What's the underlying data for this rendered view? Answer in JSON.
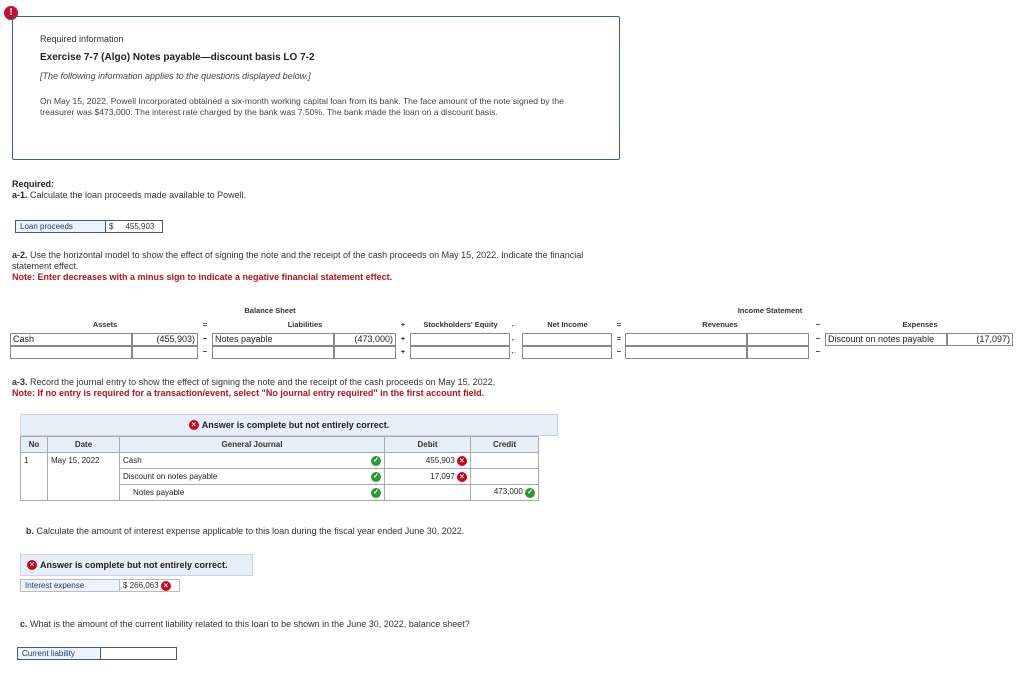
{
  "alert": {
    "icon": "!"
  },
  "info": {
    "required_label": "Required information",
    "title": "Exercise 7-7 (Algo) Notes payable—discount basis LO 7-2",
    "italic": "[The following information applies to the questions displayed below.]",
    "paragraph": "On May 15, 2022, Powell Incorporated obtained a six-month working capital loan from its bank. The face amount of the note signed by the treasurer was $473,000. The interest rate charged by the bank was 7.50%. The bank made the loan on a discount basis."
  },
  "required": {
    "label": "Required:",
    "a1_num": "a-1.",
    "a1_text": " Calculate the loan proceeds made available to Powell."
  },
  "loan_proceeds": {
    "label": "Loan proceeds",
    "dollar": "$",
    "value": "455,903"
  },
  "a2": {
    "num": "a-2.",
    "text": " Use the horizontal model to show the effect of signing the note and the receipt of the cash proceeds on May 15, 2022. Indicate the financial statement effect.",
    "note": "Note: Enter decreases with a minus sign to indicate a negative financial statement effect."
  },
  "horizontal_model": {
    "balance_sheet": "Balance Sheet",
    "income_statement": "Income Statement",
    "assets": "Assets",
    "liabilities": "Liabilities",
    "equity": "Stockholders' Equity",
    "net_income": "Net Income",
    "revenues": "Revenues",
    "expenses": "Expenses",
    "eq": "=",
    "plus": "+",
    "minus": "−",
    "arrow": "←",
    "row1": {
      "asset_label": "Cash",
      "asset_value": "(455,903)",
      "liab_label": "Notes payable",
      "liab_value": "(473,000)",
      "exp_label": "Discount on notes payable",
      "exp_value": "(17,097)"
    }
  },
  "a3": {
    "num": "a-3.",
    "text": " Record the journal entry to show the effect of signing the note and the receipt of the cash proceeds on May 15, 2022.",
    "note": "Note: If no entry is required for a transaction/event, select \"No journal entry required\" in the first account field."
  },
  "banner_text": "Answer is complete but not entirely correct.",
  "journal": {
    "headers": {
      "no": "No",
      "date": "Date",
      "gj": "General Journal",
      "debit": "Debit",
      "credit": "Credit"
    },
    "no": "1",
    "date": "May 15, 2022",
    "rows": [
      {
        "account": "Cash",
        "debit": "455,903",
        "credit": ""
      },
      {
        "account": "Discount on notes payable",
        "debit": "17,097",
        "credit": ""
      },
      {
        "account": "Notes payable",
        "debit": "",
        "credit": "473,000"
      }
    ]
  },
  "b": {
    "num": "b.",
    "text": " Calculate the amount of interest expense applicable to this loan during the fiscal year ended June 30, 2022."
  },
  "interest": {
    "label": "Interest expense",
    "value": "$ 266,063"
  },
  "c": {
    "num": "c.",
    "text": " What is the amount of the current liability related to this loan to be shown in the June 30, 2022, balance sheet?"
  },
  "current_liability": {
    "label": "Current liability",
    "value": ""
  },
  "colors": {
    "accent": "#3c5a99",
    "error": "#d0021b",
    "ok": "#2d9a36",
    "note": "#b3141a",
    "header_bg": "#e6eef8"
  }
}
